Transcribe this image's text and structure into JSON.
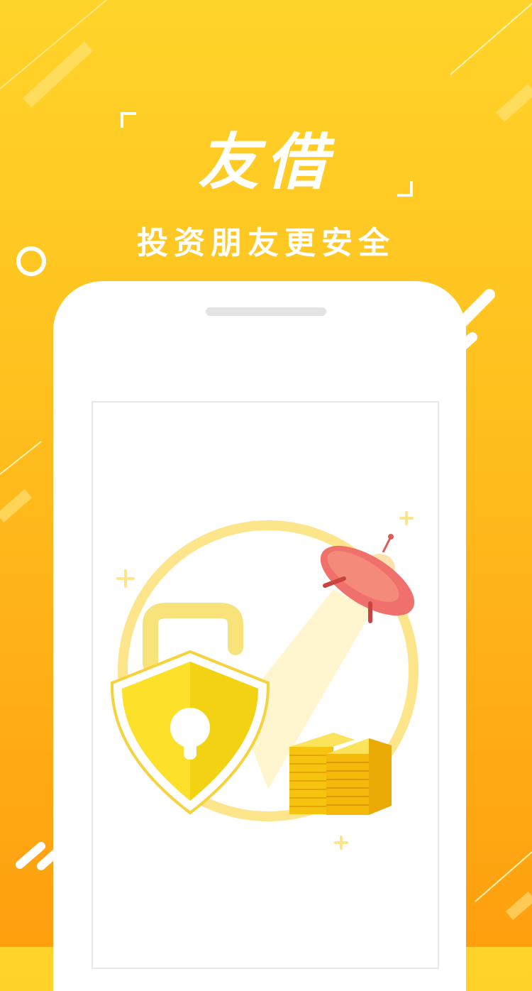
{
  "brand": {
    "title": "友借",
    "subtitle": "投资朋友更安全"
  },
  "colors": {
    "bg_top": "#ffd42a",
    "bg_bottom": "#ff9f0f",
    "shield": "#f7d51a",
    "ufo": "#f0716b",
    "coins": "#f6c40f"
  },
  "icons": [
    "lock-shield-icon",
    "ufo-icon",
    "coin-stack-icon",
    "sparkle-icon"
  ]
}
